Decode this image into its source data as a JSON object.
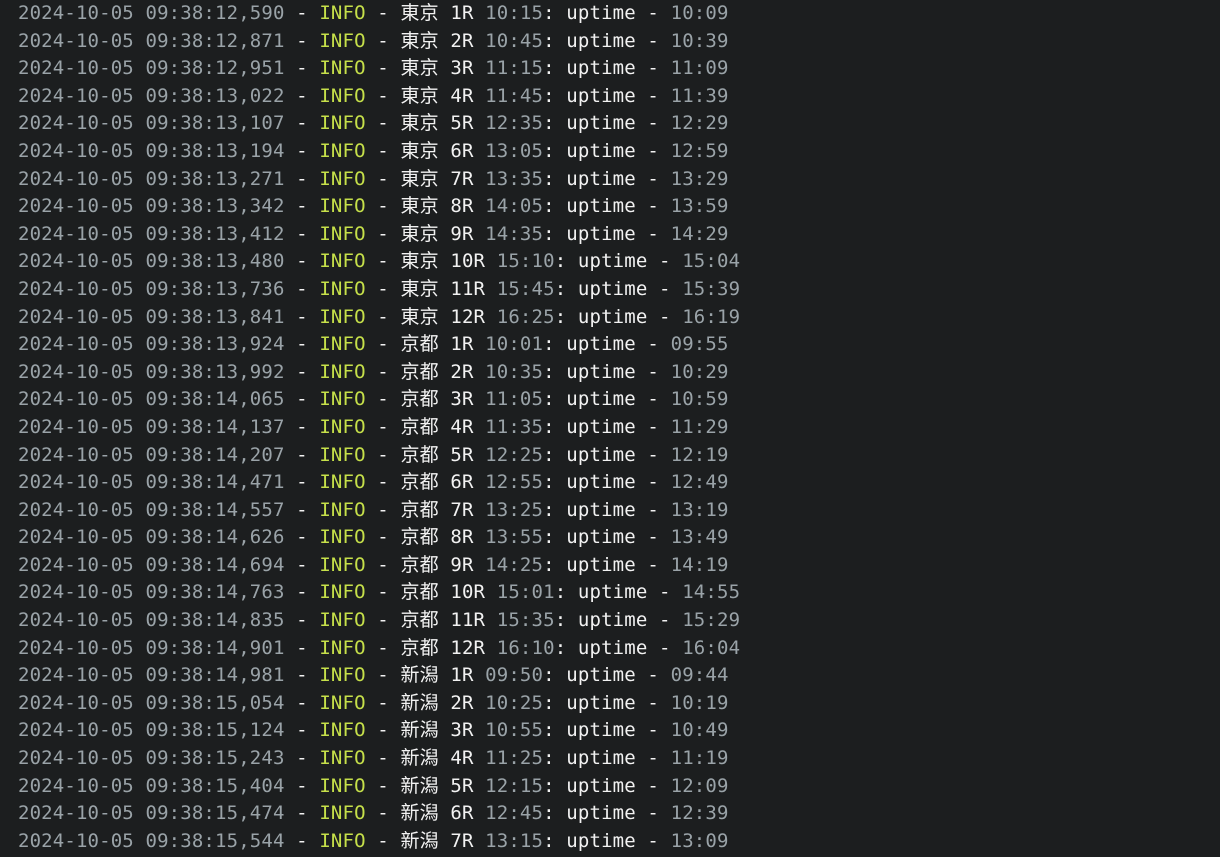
{
  "separator": " - ",
  "word": "uptime",
  "colors": {
    "background": "#1c1e1f",
    "timestamp": "#9aa3a8",
    "level": "#c6e04a",
    "text": "#f2f2f2"
  },
  "lines": [
    {
      "ts": "2024-10-05 09:38:12,590",
      "level": "INFO",
      "venue": "東京",
      "race": "1R",
      "start": "10:15",
      "uptime": "10:09"
    },
    {
      "ts": "2024-10-05 09:38:12,871",
      "level": "INFO",
      "venue": "東京",
      "race": "2R",
      "start": "10:45",
      "uptime": "10:39"
    },
    {
      "ts": "2024-10-05 09:38:12,951",
      "level": "INFO",
      "venue": "東京",
      "race": "3R",
      "start": "11:15",
      "uptime": "11:09"
    },
    {
      "ts": "2024-10-05 09:38:13,022",
      "level": "INFO",
      "venue": "東京",
      "race": "4R",
      "start": "11:45",
      "uptime": "11:39"
    },
    {
      "ts": "2024-10-05 09:38:13,107",
      "level": "INFO",
      "venue": "東京",
      "race": "5R",
      "start": "12:35",
      "uptime": "12:29"
    },
    {
      "ts": "2024-10-05 09:38:13,194",
      "level": "INFO",
      "venue": "東京",
      "race": "6R",
      "start": "13:05",
      "uptime": "12:59"
    },
    {
      "ts": "2024-10-05 09:38:13,271",
      "level": "INFO",
      "venue": "東京",
      "race": "7R",
      "start": "13:35",
      "uptime": "13:29"
    },
    {
      "ts": "2024-10-05 09:38:13,342",
      "level": "INFO",
      "venue": "東京",
      "race": "8R",
      "start": "14:05",
      "uptime": "13:59"
    },
    {
      "ts": "2024-10-05 09:38:13,412",
      "level": "INFO",
      "venue": "東京",
      "race": "9R",
      "start": "14:35",
      "uptime": "14:29"
    },
    {
      "ts": "2024-10-05 09:38:13,480",
      "level": "INFO",
      "venue": "東京",
      "race": "10R",
      "start": "15:10",
      "uptime": "15:04"
    },
    {
      "ts": "2024-10-05 09:38:13,736",
      "level": "INFO",
      "venue": "東京",
      "race": "11R",
      "start": "15:45",
      "uptime": "15:39"
    },
    {
      "ts": "2024-10-05 09:38:13,841",
      "level": "INFO",
      "venue": "東京",
      "race": "12R",
      "start": "16:25",
      "uptime": "16:19"
    },
    {
      "ts": "2024-10-05 09:38:13,924",
      "level": "INFO",
      "venue": "京都",
      "race": "1R",
      "start": "10:01",
      "uptime": "09:55"
    },
    {
      "ts": "2024-10-05 09:38:13,992",
      "level": "INFO",
      "venue": "京都",
      "race": "2R",
      "start": "10:35",
      "uptime": "10:29"
    },
    {
      "ts": "2024-10-05 09:38:14,065",
      "level": "INFO",
      "venue": "京都",
      "race": "3R",
      "start": "11:05",
      "uptime": "10:59"
    },
    {
      "ts": "2024-10-05 09:38:14,137",
      "level": "INFO",
      "venue": "京都",
      "race": "4R",
      "start": "11:35",
      "uptime": "11:29"
    },
    {
      "ts": "2024-10-05 09:38:14,207",
      "level": "INFO",
      "venue": "京都",
      "race": "5R",
      "start": "12:25",
      "uptime": "12:19"
    },
    {
      "ts": "2024-10-05 09:38:14,471",
      "level": "INFO",
      "venue": "京都",
      "race": "6R",
      "start": "12:55",
      "uptime": "12:49"
    },
    {
      "ts": "2024-10-05 09:38:14,557",
      "level": "INFO",
      "venue": "京都",
      "race": "7R",
      "start": "13:25",
      "uptime": "13:19"
    },
    {
      "ts": "2024-10-05 09:38:14,626",
      "level": "INFO",
      "venue": "京都",
      "race": "8R",
      "start": "13:55",
      "uptime": "13:49"
    },
    {
      "ts": "2024-10-05 09:38:14,694",
      "level": "INFO",
      "venue": "京都",
      "race": "9R",
      "start": "14:25",
      "uptime": "14:19"
    },
    {
      "ts": "2024-10-05 09:38:14,763",
      "level": "INFO",
      "venue": "京都",
      "race": "10R",
      "start": "15:01",
      "uptime": "14:55"
    },
    {
      "ts": "2024-10-05 09:38:14,835",
      "level": "INFO",
      "venue": "京都",
      "race": "11R",
      "start": "15:35",
      "uptime": "15:29"
    },
    {
      "ts": "2024-10-05 09:38:14,901",
      "level": "INFO",
      "venue": "京都",
      "race": "12R",
      "start": "16:10",
      "uptime": "16:04"
    },
    {
      "ts": "2024-10-05 09:38:14,981",
      "level": "INFO",
      "venue": "新潟",
      "race": "1R",
      "start": "09:50",
      "uptime": "09:44"
    },
    {
      "ts": "2024-10-05 09:38:15,054",
      "level": "INFO",
      "venue": "新潟",
      "race": "2R",
      "start": "10:25",
      "uptime": "10:19"
    },
    {
      "ts": "2024-10-05 09:38:15,124",
      "level": "INFO",
      "venue": "新潟",
      "race": "3R",
      "start": "10:55",
      "uptime": "10:49"
    },
    {
      "ts": "2024-10-05 09:38:15,243",
      "level": "INFO",
      "venue": "新潟",
      "race": "4R",
      "start": "11:25",
      "uptime": "11:19"
    },
    {
      "ts": "2024-10-05 09:38:15,404",
      "level": "INFO",
      "venue": "新潟",
      "race": "5R",
      "start": "12:15",
      "uptime": "12:09"
    },
    {
      "ts": "2024-10-05 09:38:15,474",
      "level": "INFO",
      "venue": "新潟",
      "race": "6R",
      "start": "12:45",
      "uptime": "12:39"
    },
    {
      "ts": "2024-10-05 09:38:15,544",
      "level": "INFO",
      "venue": "新潟",
      "race": "7R",
      "start": "13:15",
      "uptime": "13:09"
    }
  ]
}
